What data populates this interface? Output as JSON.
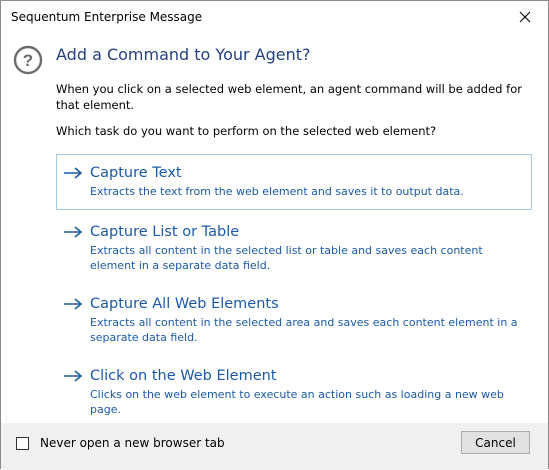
{
  "window": {
    "title": "Sequentum Enterprise Message",
    "close_icon": "close-icon"
  },
  "dialog": {
    "icon": "question-icon",
    "heading": "Add a Command to Your Agent?",
    "intro": "When you click on a selected web element, an agent command will be added for that element.",
    "question": "Which task do you want to perform on the selected web element?",
    "accent_color": "#1a5aa6",
    "commands": [
      {
        "title": "Capture Text",
        "description": "Extracts the text from the web element and saves it to output data.",
        "selected": true
      },
      {
        "title": "Capture List or Table",
        "description": "Extracts all content in the selected list or table and saves each content element in a separate data field.",
        "selected": false
      },
      {
        "title": "Capture All Web Elements",
        "description": "Extracts all content in the selected area and saves each content element in a separate data field.",
        "selected": false
      },
      {
        "title": "Click on the Web Element",
        "description": "Clicks on the web element to execute an action such as loading a new web page.",
        "selected": false
      }
    ]
  },
  "footer": {
    "checkbox_label": "Never open a new browser tab",
    "checkbox_checked": false,
    "cancel_label": "Cancel"
  }
}
